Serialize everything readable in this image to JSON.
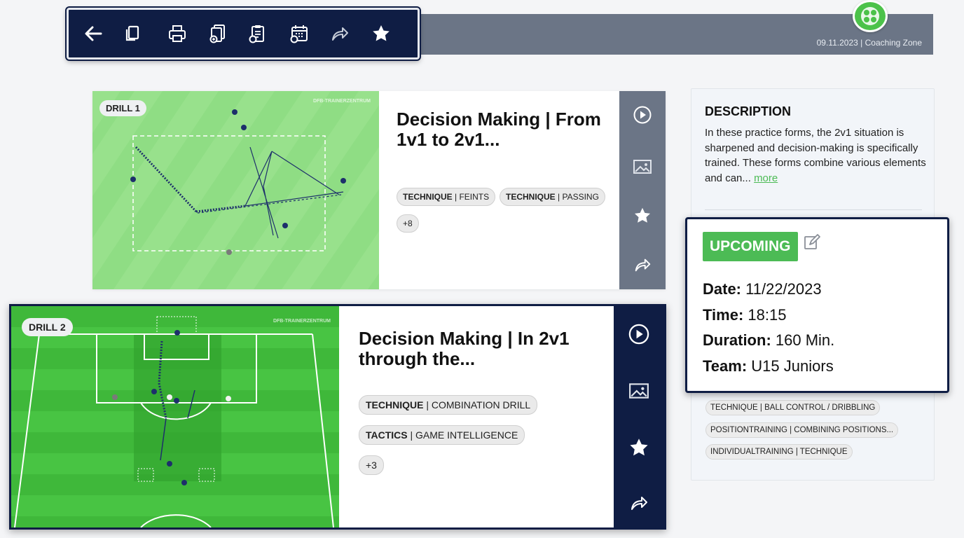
{
  "header": {
    "date": "09.11.2023",
    "zone": "Coaching Zone",
    "separator": "|"
  },
  "toolbar": {
    "icons": [
      "back-arrow-icon",
      "copy-icon",
      "print-icon",
      "session-document-icon",
      "clipboard-icon",
      "calendar-icon",
      "share-icon",
      "favorite-star-icon"
    ]
  },
  "drills": [
    {
      "badge": "DRILL 1",
      "watermark": "DFB-TRAINERZENTRUM",
      "title": "Decision Making | From 1v1 to 2v1...",
      "tags": [
        {
          "category": "TECHNIQUE",
          "sep": " | ",
          "label": "FEINTS"
        },
        {
          "category": "TECHNIQUE",
          "sep": " | ",
          "label": "PASSING"
        }
      ],
      "more_tags": "+8"
    },
    {
      "badge": "DRILL 2",
      "watermark": "DFB-TRAINERZENTRUM",
      "title": "Decision Making | In 2v1 through the...",
      "tags": [
        {
          "category": "TECHNIQUE",
          "sep": " | ",
          "label": "COMBINATION DRILL"
        },
        {
          "category": "TACTICS",
          "sep": " | ",
          "label": "GAME INTELLIGENCE"
        }
      ],
      "more_tags": "+3"
    }
  ],
  "description": {
    "title": "DESCRIPTION",
    "text": "In these practice forms, the 2v1 situation is sharpened and decision-making is specifically trained. These forms combine various elements and can... ",
    "more_link": "more",
    "tags": [
      "TECHNIQUE | BALL CONTROL / DRIBBLING",
      "POSITIONTRAINING | COMBINING POSITIONS...",
      "INDIVIDUALTRAINING | TECHNIQUE"
    ]
  },
  "event": {
    "status": "UPCOMING",
    "date_label": "Date:",
    "date_value": "11/22/2023",
    "time_label": "Time:",
    "time_value": "18:15",
    "duration_label": "Duration:",
    "duration_value": "160 Min.",
    "team_label": "Team:",
    "team_value": "U15 Juniors"
  },
  "colors": {
    "navy": "#0f1d44",
    "slate": "#6b7586",
    "green": "#4cbb55",
    "pitch_light": "#8fdd84",
    "pitch_dark": "#3fb83a"
  }
}
